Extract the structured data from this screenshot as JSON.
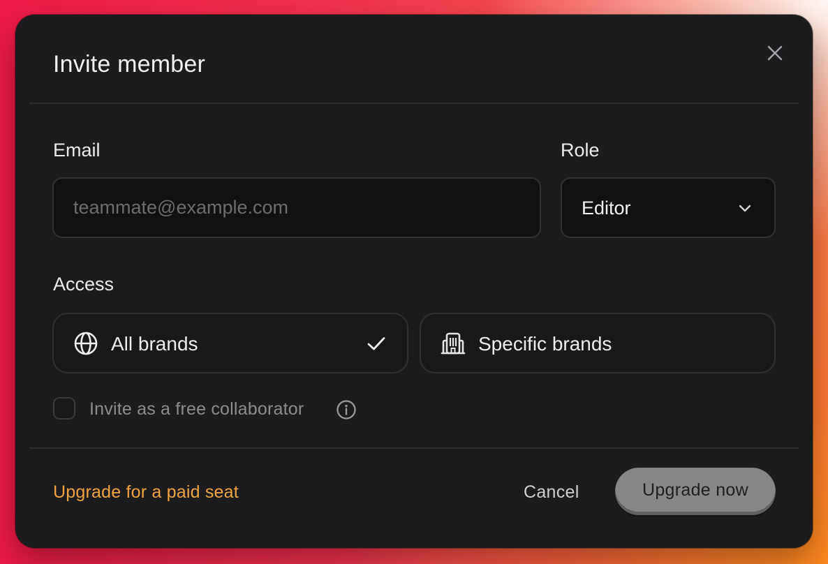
{
  "dialog": {
    "title": "Invite member",
    "close_icon": "close-icon"
  },
  "email": {
    "label": "Email",
    "value": "",
    "placeholder": "teammate@example.com"
  },
  "role": {
    "label": "Role",
    "selected": "Editor",
    "icon": "chevron-down-icon"
  },
  "access": {
    "label": "Access",
    "options": [
      {
        "label": "All brands",
        "icon": "globe-icon",
        "selected": true
      },
      {
        "label": "Specific brands",
        "icon": "building-icon",
        "selected": false
      }
    ]
  },
  "collaborator": {
    "label": "Invite as a free collaborator",
    "checked": false,
    "info_icon": "info-icon"
  },
  "footer": {
    "upgrade_link": "Upgrade for a paid seat",
    "cancel_label": "Cancel",
    "primary_label": "Upgrade now"
  },
  "colors": {
    "dialog_background": "#1c1c1e",
    "link_accent": "#f0a340",
    "primary_button": "#87878a"
  }
}
